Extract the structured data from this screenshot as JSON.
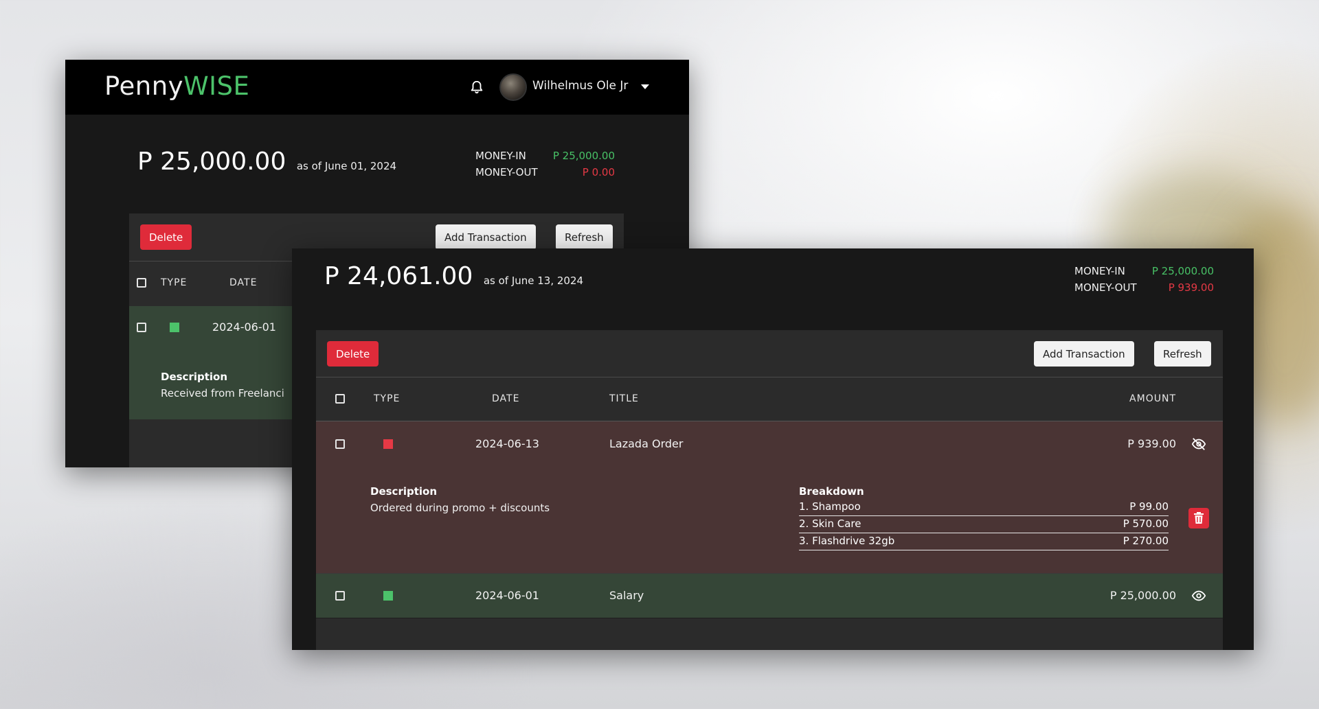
{
  "brand": {
    "part1": "Penny",
    "part2": "WISE",
    "accent": "#4cc26a"
  },
  "user": {
    "name": "Wilhelmus Ole Jr"
  },
  "colors": {
    "money_in": "#48c166",
    "money_out": "#e53945",
    "delete": "#df2b3a",
    "row_out": "#4a3434",
    "row_in": "#354637"
  },
  "back_window": {
    "balance": "P 25,000.00",
    "as_of": "as of June 01, 2024",
    "money_in_label": "MONEY-IN",
    "money_in_value": "P 25,000.00",
    "money_out_label": "MONEY-OUT",
    "money_out_value": "P 0.00",
    "delete_label": "Delete",
    "add_label": "Add Transaction",
    "refresh_label": "Refresh",
    "columns": {
      "type": "TYPE",
      "date": "DATE"
    },
    "row": {
      "date": "2024-06-01",
      "description_heading": "Description",
      "description": "Received from Freelanci"
    }
  },
  "front_window": {
    "balance": "P 24,061.00",
    "as_of": "as of June 13, 2024",
    "money_in_label": "MONEY-IN",
    "money_in_value": "P 25,000.00",
    "money_out_label": "MONEY-OUT",
    "money_out_value": "P 939.00",
    "delete_label": "Delete",
    "add_label": "Add Transaction",
    "refresh_label": "Refresh",
    "columns": {
      "type": "TYPE",
      "date": "DATE",
      "title": "TITLE",
      "amount": "AMOUNT"
    },
    "rows": [
      {
        "type": "money-out",
        "date": "2024-06-13",
        "title": "Lazada Order",
        "amount": "P 939.00",
        "description_heading": "Description",
        "description": "Ordered during promo + discounts",
        "breakdown_heading": "Breakdown",
        "breakdown": [
          {
            "name": "1. Shampoo",
            "amount": "P 99.00"
          },
          {
            "name": "2. Skin Care",
            "amount": "P 570.00"
          },
          {
            "name": "3. Flashdrive 32gb",
            "amount": "P 270.00"
          }
        ]
      },
      {
        "type": "money-in",
        "date": "2024-06-01",
        "title": "Salary",
        "amount": "P 25,000.00"
      }
    ]
  }
}
